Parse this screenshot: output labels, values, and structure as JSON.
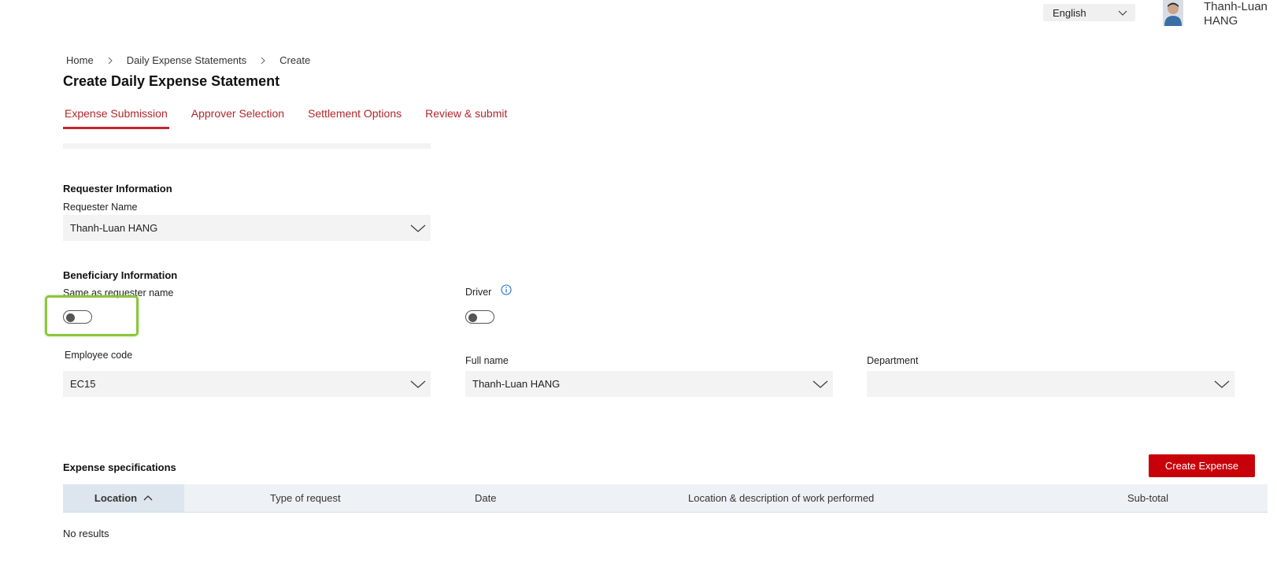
{
  "header": {
    "language": "English",
    "user_name": "Thanh-Luan\nHANG"
  },
  "breadcrumb": {
    "items": [
      "Home",
      "Daily Expense Statements",
      "Create"
    ]
  },
  "page": {
    "title": "Create Daily Expense Statement"
  },
  "tabs": [
    {
      "label": "Expense Submission",
      "active": true
    },
    {
      "label": "Approver Selection",
      "active": false
    },
    {
      "label": "Settlement Options",
      "active": false
    },
    {
      "label": "Review & submit",
      "active": false
    }
  ],
  "requester": {
    "section_title": "Requester Information",
    "name_label": "Requester Name",
    "name_value": "Thanh-Luan HANG"
  },
  "beneficiary": {
    "section_title": "Beneficiary Information",
    "same_as_label": "Same as requester name",
    "same_as_on": false,
    "driver_label": "Driver",
    "driver_on": false,
    "employee_code_label": "Employee code",
    "employee_code_value": "EC15",
    "full_name_label": "Full name",
    "full_name_value": "Thanh-Luan HANG",
    "department_label": "Department",
    "department_value": ""
  },
  "expenses": {
    "section_title": "Expense specifications",
    "create_button": "Create Expense",
    "columns": [
      "Location",
      "Type of request",
      "Date",
      "Location & description of work performed",
      "Sub-total"
    ],
    "empty_text": "No results"
  },
  "colors": {
    "accent": "#c4262e",
    "button": "#c8000a",
    "highlight": "#8cc63f",
    "info": "#1a6fc9"
  }
}
